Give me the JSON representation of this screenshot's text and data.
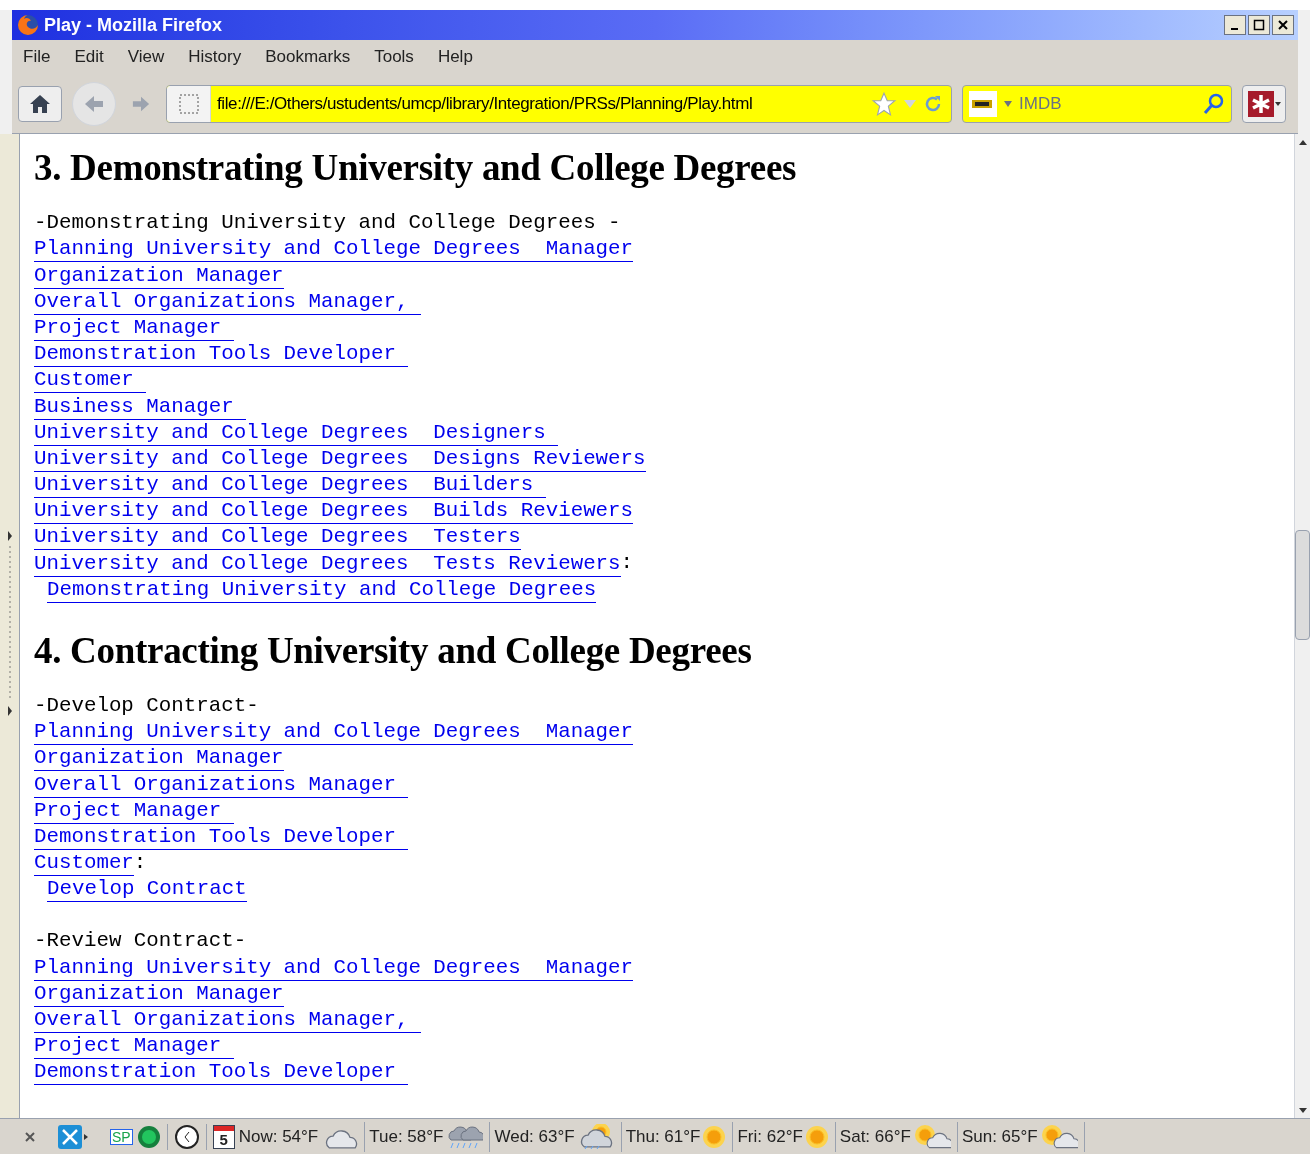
{
  "window": {
    "title": "Play - Mozilla Firefox"
  },
  "menu": [
    {
      "label": "File"
    },
    {
      "label": "Edit"
    },
    {
      "label": "View"
    },
    {
      "label": "History"
    },
    {
      "label": "Bookmarks"
    },
    {
      "label": "Tools"
    },
    {
      "label": "Help"
    }
  ],
  "address_bar": {
    "value": "file:///E:/Others/ustudents/umcp/library/Integration/PRSs/Planning/Play.html"
  },
  "search": {
    "placeholder": "IMDB"
  },
  "sections": [
    {
      "heading": "3. Demonstrating University and College Degrees",
      "blocks": [
        {
          "title": "-Demonstrating University and College Degrees -",
          "roles": [
            {
              "text": "Planning University and College Degrees  Manager"
            },
            {
              "text": "Organization Manager"
            },
            {
              "text": "Overall Organizations Manager, "
            },
            {
              "text": "Project Manager "
            },
            {
              "text": "Demonstration Tools Developer "
            },
            {
              "text": "Customer "
            },
            {
              "text": "Business Manager "
            },
            {
              "text": "University and College Degrees  Designers "
            },
            {
              "text": "University and College Degrees  Designs Reviewers"
            },
            {
              "text": "University and College Degrees  Builders "
            },
            {
              "text": "University and College Degrees  Builds Reviewers"
            },
            {
              "text": "University and College Degrees  Testers"
            },
            {
              "text": "University and College Degrees  Tests Reviewers"
            }
          ],
          "suffix": ":",
          "action": "Demonstrating University and College Degrees"
        }
      ]
    },
    {
      "heading": "4. Contracting University and College Degrees",
      "blocks": [
        {
          "title": "-Develop Contract-",
          "roles": [
            {
              "text": "Planning University and College Degrees  Manager"
            },
            {
              "text": "Organization Manager"
            },
            {
              "text": "Overall Organizations Manager "
            },
            {
              "text": "Project Manager "
            },
            {
              "text": "Demonstration Tools Developer "
            },
            {
              "text": "Customer"
            }
          ],
          "suffix": ":",
          "action": "Develop Contract"
        },
        {
          "title": "-Review Contract-",
          "roles": [
            {
              "text": "Planning University and College Degrees  Manager"
            },
            {
              "text": "Organization Manager"
            },
            {
              "text": "Overall Organizations Manager, "
            },
            {
              "text": "Project Manager "
            },
            {
              "text": "Demonstration Tools Developer "
            }
          ]
        }
      ]
    }
  ],
  "status_bar": {
    "sp_label": "SP",
    "calendar_day": "5",
    "weather": [
      {
        "label": "Now: 54°F",
        "kind": "cloudy"
      },
      {
        "label": "Tue: 58°F",
        "kind": "rain"
      },
      {
        "label": "Wed: 63°F",
        "kind": "showers"
      },
      {
        "label": "Thu: 61°F",
        "kind": "sunny"
      },
      {
        "label": "Fri: 62°F",
        "kind": "sunny"
      },
      {
        "label": "Sat: 66°F",
        "kind": "partly"
      },
      {
        "label": "Sun: 65°F",
        "kind": "partly"
      }
    ]
  }
}
